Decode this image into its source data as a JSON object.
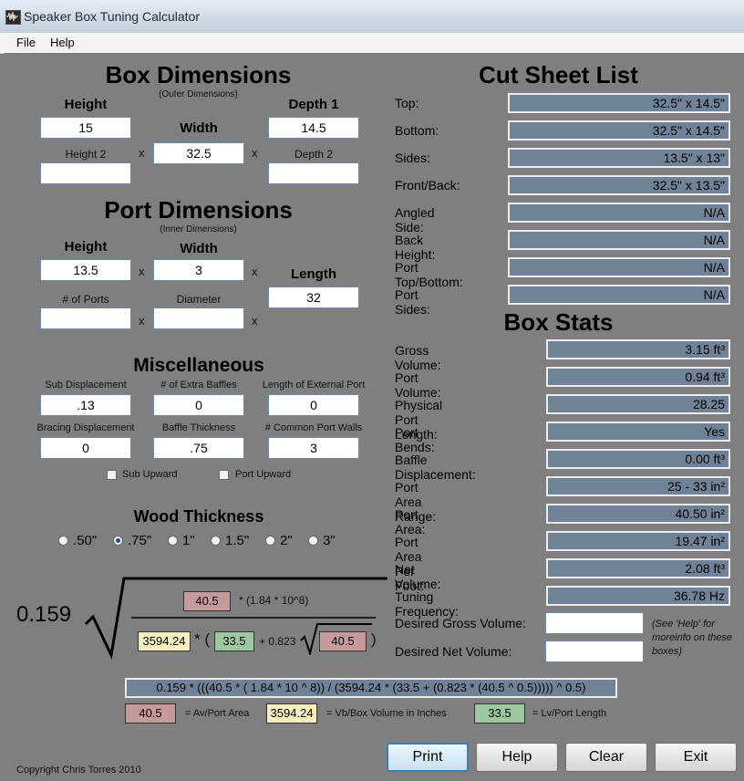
{
  "window": {
    "title": "Speaker Box Tuning Calculator"
  },
  "menu": {
    "file": "File",
    "help": "Help"
  },
  "box": {
    "title": "Box Dimensions",
    "subtitle": "(Outer Dimensions)",
    "height_label": "Height",
    "height_value": "15",
    "width_label": "Width",
    "width_value": "32.5",
    "depth1_label": "Depth 1",
    "depth1_value": "14.5",
    "height2_label": "Height 2",
    "height2_value": "",
    "depth2_label": "Depth 2",
    "depth2_value": "",
    "x": "x"
  },
  "port": {
    "title": "Port Dimensions",
    "subtitle": "(Inner Dimensions)",
    "height_label": "Height",
    "height_value": "13.5",
    "width_label": "Width",
    "width_value": "3",
    "length_label": "Length",
    "length_value": "32",
    "ports_label": "# of Ports",
    "ports_value": "",
    "diameter_label": "Diameter",
    "diameter_value": ""
  },
  "misc": {
    "title": "Miscellaneous",
    "sub_disp_label": "Sub Displacement",
    "sub_disp_value": ".13",
    "extra_baffles_label": "# of Extra Baffles",
    "extra_baffles_value": "0",
    "ext_port_label": "Length of External Port",
    "ext_port_value": "0",
    "bracing_label": "Bracing Displacement",
    "bracing_value": "0",
    "baffle_thick_label": "Baffle Thickness",
    "baffle_thick_value": ".75",
    "common_walls_label": "# Common Port Walls",
    "common_walls_value": "3",
    "sub_upward": "Sub Upward",
    "port_upward": "Port Upward"
  },
  "wood": {
    "title": "Wood Thickness",
    "options": [
      ".50\"",
      ".75\"",
      "1\"",
      "1.5\"",
      "2\"",
      "3\""
    ],
    "selected_index": 1
  },
  "cut_sheet": {
    "title": "Cut Sheet List",
    "rows": [
      {
        "label": "Top:",
        "value": "32.5\" x 14.5\""
      },
      {
        "label": "Bottom:",
        "value": "32.5\" x 14.5\""
      },
      {
        "label": "Sides:",
        "value": "13.5\" x 13\""
      },
      {
        "label": "Front/Back:",
        "value": "32.5\" x 13.5\""
      },
      {
        "label": "Angled Side:",
        "value": "N/A"
      },
      {
        "label": "Back Height:",
        "value": "N/A"
      },
      {
        "label": "Port Top/Bottom:",
        "value": "N/A"
      },
      {
        "label": "Port Sides:",
        "value": "N/A"
      }
    ]
  },
  "stats": {
    "title": "Box Stats",
    "rows": [
      {
        "label": "Gross Volume:",
        "value": "3.15 ft³"
      },
      {
        "label": "Port Volume:",
        "value": "0.94 ft³"
      },
      {
        "label": "Physical Port Length:",
        "value": "28.25"
      },
      {
        "label": "Port Bends:",
        "value": "Yes"
      },
      {
        "label": "Baffle Displacement:",
        "value": "0.00 ft³"
      },
      {
        "label": "Port Area Range:",
        "value": "25 - 33 in²"
      },
      {
        "label": "Port Area:",
        "value": "40.50 in²"
      },
      {
        "label": "Port Area Per Foot:",
        "value": "19.47 in²"
      },
      {
        "label": "Net Volume:",
        "value": "2.08 ft³"
      },
      {
        "label": "Tuning Frequency:",
        "value": "36.78 Hz"
      }
    ],
    "desired_gross_label": "Desired Gross Volume:",
    "desired_gross_value": "",
    "desired_net_label": "Desired Net Volume:",
    "desired_net_value": "",
    "help_note": "(See 'Help' for moreinfo on these boxes)"
  },
  "formula": {
    "constant": "0.159",
    "av_top": "40.5",
    "numer_rest": "* (1.84 * 10^8)",
    "vb": "3594.24",
    "star_open": "* (",
    "lv": "33.5",
    "plus_const": "+ 0.823",
    "av_inner": "40.5",
    "close_paren": ")",
    "expression": "0.159 * (((40.5 * ( 1.84 * 10 ^ 8)) / (3594.24 * (33.5 + (0.823 * (40.5 ^ 0.5))))) ^ 0.5)",
    "legend": [
      {
        "value": "40.5",
        "text": "= Av/Port Area"
      },
      {
        "value": "3594.24",
        "text": "= Vb/Box Volume in Inches"
      },
      {
        "value": "33.5",
        "text": "= Lv/Port Length"
      }
    ]
  },
  "footer": {
    "copyright": "Copyright Chris Torres 2010"
  },
  "buttons": {
    "print": "Print",
    "help": "Help",
    "clear": "Clear",
    "exit": "Exit"
  }
}
